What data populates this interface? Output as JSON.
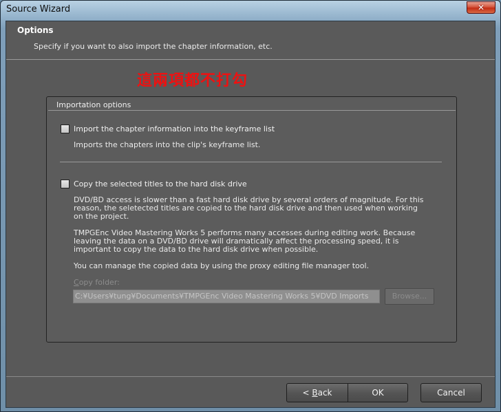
{
  "window": {
    "title": "Source Wizard",
    "close_glyph": "✕",
    "close_icon": "close-icon"
  },
  "header": {
    "title": "Options",
    "subtitle": "Specify if you want to also import the chapter information, etc."
  },
  "annotation": {
    "text": "這兩項都不打勾",
    "color": "#ee1111"
  },
  "importation": {
    "group_title": "Importation options",
    "chapter": {
      "label": "Import the chapter information into the keyframe list",
      "checked": false,
      "description": "Imports the chapters into the clip's keyframe list."
    },
    "copy": {
      "label": "Copy the selected titles to the hard disk drive",
      "checked": false,
      "description_1": "DVD/BD access is slower than a fast hard disk drive by several orders of magnitude. For this reason, the seletected titles are copied to the hard disk drive and then used when working on the project.",
      "description_2": "TMPGEnc Video Mastering Works 5 performs many accesses during editing work. Because leaving the data on a DVD/BD drive will dramatically affect the processing speed, it is important to copy the data to the hard disk drive when possible.",
      "description_3": "You can manage the copied data by using the proxy editing file manager tool.",
      "folder_label_prefix": "C",
      "folder_label_rest": "opy folder:",
      "folder_path": "C:¥Users¥tung¥Documents¥TMPGEnc Video Mastering Works 5¥DVD Imports",
      "browse_label": "Browse..."
    }
  },
  "footer": {
    "back_arrow": "<",
    "back_ul": "B",
    "back_rest": "ack",
    "ok_label": "OK",
    "cancel_label": "Cancel"
  }
}
